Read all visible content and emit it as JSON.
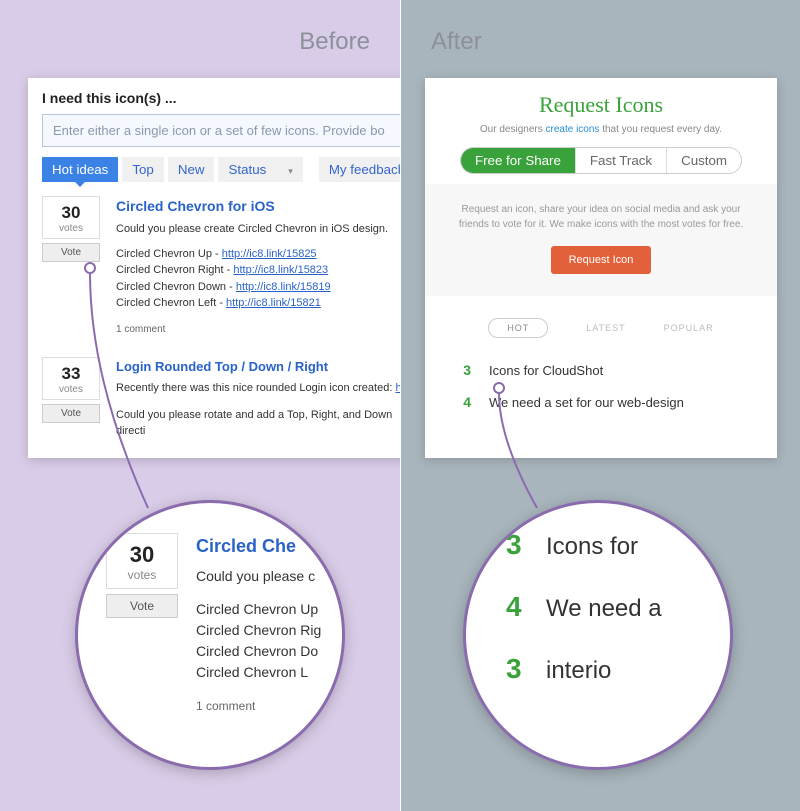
{
  "labels": {
    "before": "Before",
    "after": "After"
  },
  "before": {
    "heading": "I need this icon(s) ...",
    "placeholder": "Enter either a single icon or a set of few icons. Provide bo",
    "tabs": {
      "hot": "Hot ideas",
      "top": "Top",
      "new": "New",
      "status": "Status",
      "feedback": "My feedback"
    },
    "ideas": [
      {
        "votes": "30",
        "votes_label": "votes",
        "vote_btn": "Vote",
        "title": "Circled Chevron for iOS",
        "desc": "Could you please create Circled Chevron in iOS design.",
        "lines": [
          {
            "label": "Circled Chevron Up - ",
            "url": "http://ic8.link/15825"
          },
          {
            "label": "Circled Chevron Right - ",
            "url": "http://ic8.link/15823"
          },
          {
            "label": "Circled Chevron Down - ",
            "url": "http://ic8.link/15819"
          },
          {
            "label": "Circled Chevron Left - ",
            "url": "http://ic8.link/15821"
          }
        ],
        "comment": "1 comment"
      },
      {
        "votes": "33",
        "votes_label": "votes",
        "vote_btn": "Vote",
        "title": "Login Rounded Top / Down / Right",
        "desc_pre": "Recently there was this nice rounded Login icon created: ",
        "desc_url": "http://",
        "desc2": "Could you please rotate and add a Top, Right, and Down directi"
      }
    ]
  },
  "after": {
    "title": "Request Icons",
    "sub_pre": "Our designers ",
    "sub_link": "create icons",
    "sub_post": " that you request every day.",
    "pills": {
      "free": "Free for Share",
      "fast": "Fast Track",
      "custom": "Custom"
    },
    "middle_text": "Request an icon, share your idea on social media and ask your friends to vote for it. We make icons with the most votes for free.",
    "request_btn": "Request Icon",
    "tabs": {
      "hot": "HOT",
      "latest": "LATEST",
      "popular": "POPULAR"
    },
    "list": [
      {
        "num": "3",
        "txt": "Icons for CloudShot"
      },
      {
        "num": "4",
        "txt": "We need a set for our web-design"
      }
    ]
  },
  "zoom_left": {
    "votes": "30",
    "votes_label": "votes",
    "vote_btn": "Vote",
    "title": "Circled Che",
    "desc": "Could you please c",
    "lines": [
      "Circled Chevron Up",
      "Circled Chevron Rig",
      "Circled Chevron Do",
      "Circled Chevron L"
    ],
    "comment": "1 comment"
  },
  "zoom_right": {
    "rows": [
      {
        "num": "3",
        "txt": "Icons for"
      },
      {
        "num": "4",
        "txt": "We need a"
      },
      {
        "num": "3",
        "txt": "interio"
      }
    ]
  }
}
